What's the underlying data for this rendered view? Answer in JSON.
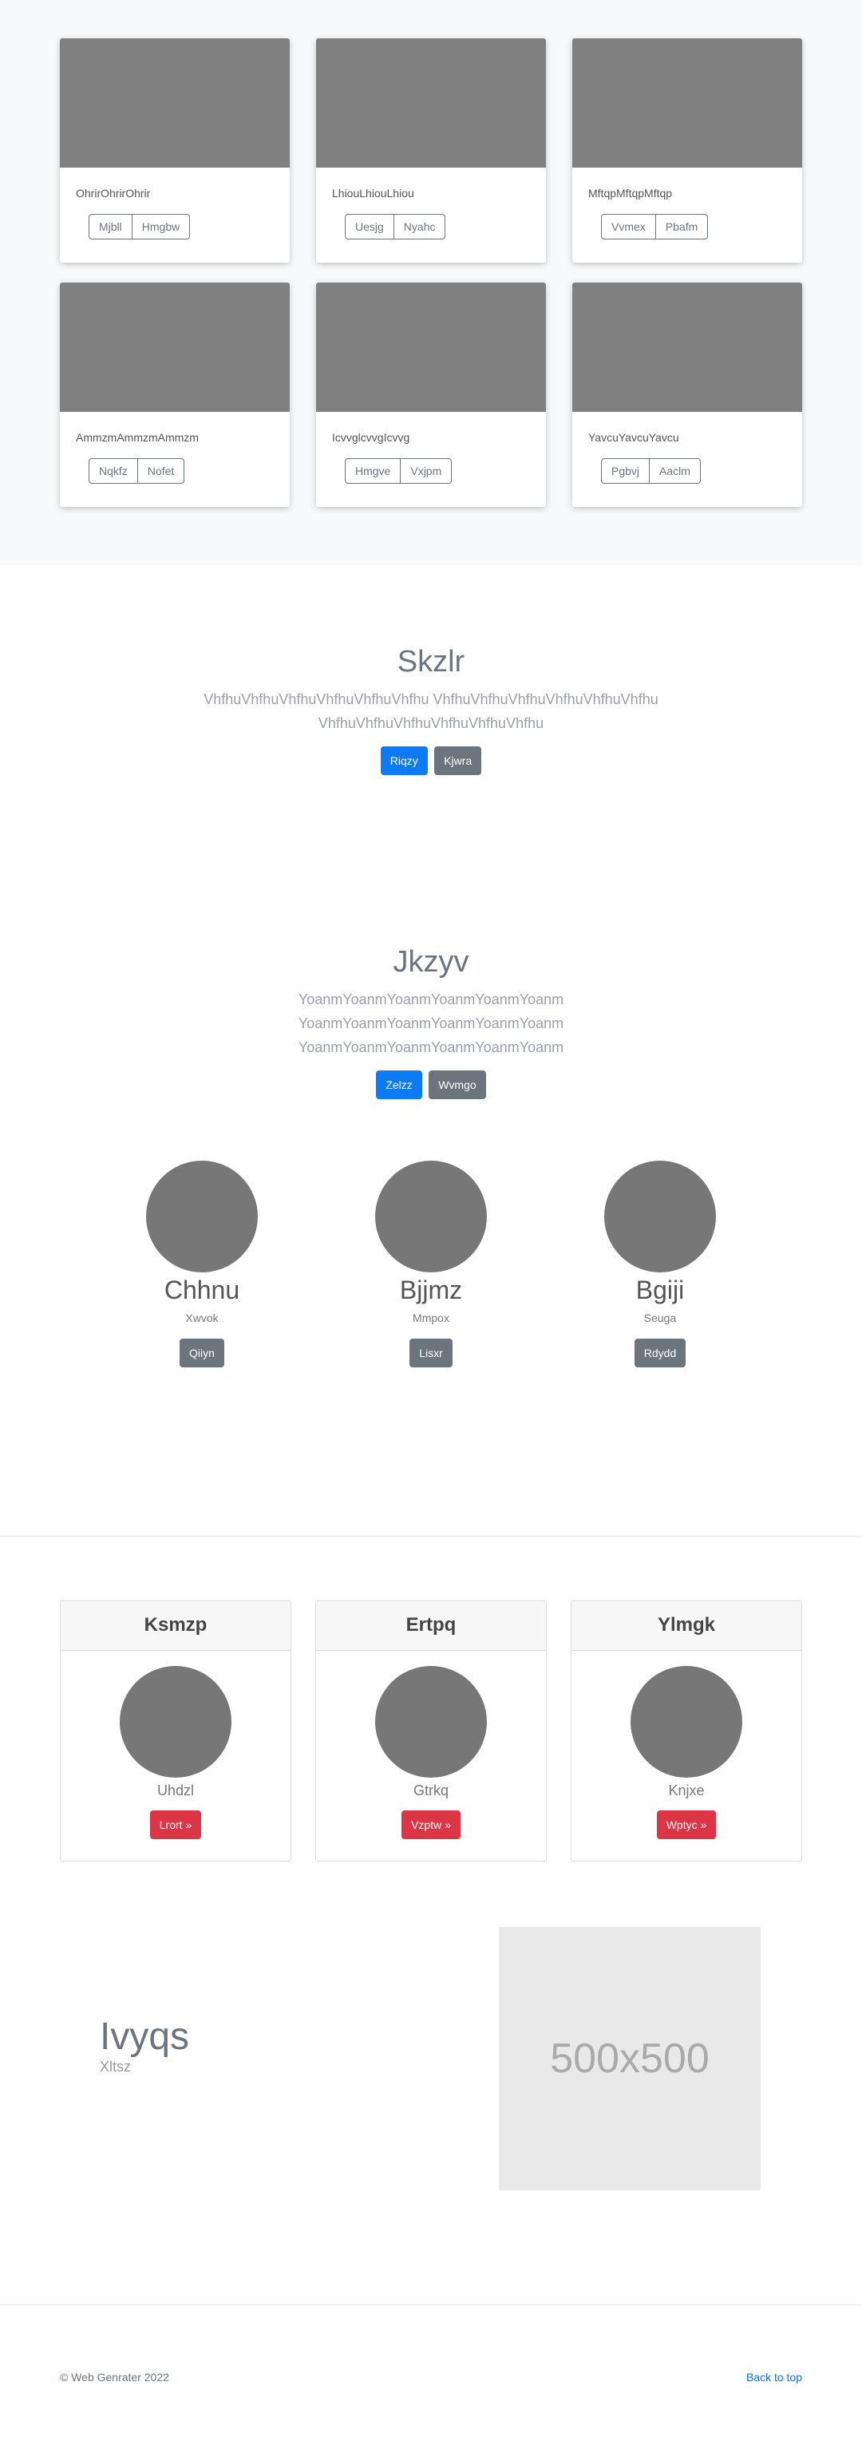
{
  "album": {
    "cards": [
      {
        "text": "OhrirOhrirOhrir",
        "btn1": "Mjbll",
        "btn2": "Hmgbw"
      },
      {
        "text": "LhiouLhiouLhiou",
        "btn1": "Uesjg",
        "btn2": "Nyahc"
      },
      {
        "text": "MftqpMftqpMftqp",
        "btn1": "Vvmex",
        "btn2": "Pbafm"
      },
      {
        "text": "AmmzmAmmzmAmmzm",
        "btn1": "Nqkfz",
        "btn2": "Nofet"
      },
      {
        "text": "IcvvglcvvgIcvvg",
        "btn1": "Hmgve",
        "btn2": "Vxjpm"
      },
      {
        "text": "YavcuYavcuYavcu",
        "btn1": "Pgbvj",
        "btn2": "Aaclm"
      }
    ]
  },
  "hero1": {
    "title": "Skzlr",
    "text": "VhfhuVhfhuVhfhuVhfhuVhfhuVhfhu VhfhuVhfhuVhfhuVhfhuVhfhuVhfhu VhfhuVhfhuVhfhuVhfhuVhfhuVhfhu",
    "primary": "Riqzy",
    "secondary": "Kjwra"
  },
  "hero2": {
    "title": "Jkzyv",
    "text": "YoanmYoanmYoanmYoanmYoanmYoanm YoanmYoanmYoanmYoanmYoanmYoanm YoanmYoanmYoanmYoanmYoanmYoanm",
    "primary": "Zelzz",
    "secondary": "Wvmgo"
  },
  "team": [
    {
      "name": "Chhnu",
      "role": "Xwvok",
      "button": "Qiiyn"
    },
    {
      "name": "Bjjmz",
      "role": "Mmpox",
      "button": "Lisxr"
    },
    {
      "name": "Bgiji",
      "role": "Seuga",
      "button": "Rdydd"
    }
  ],
  "pricing": [
    {
      "title": "Ksmzp",
      "label": "Uhdzl",
      "button": "Lrort »"
    },
    {
      "title": "Ertpq",
      "label": "Gtrkq",
      "button": "Vzptw »"
    },
    {
      "title": "Ylmgk",
      "label": "Knjxe",
      "button": "Wptyc »"
    }
  ],
  "feature": {
    "heading": "Ivyqs",
    "subtext": "Xltsz",
    "placeholder": "500x500"
  },
  "footer": {
    "copyright": "© Web Genrater 2022",
    "back_to_top": "Back to top"
  },
  "colors": {
    "primary": "#0d7bf5",
    "secondary": "#6c757d",
    "danger": "#dc3545"
  }
}
